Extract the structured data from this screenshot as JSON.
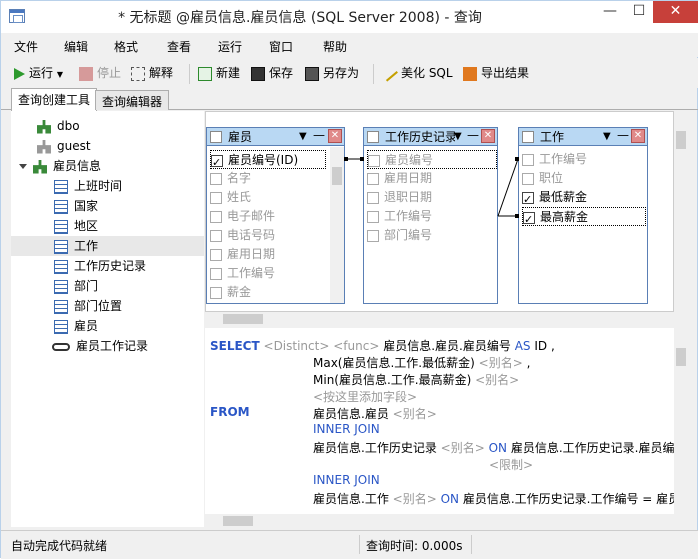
{
  "window": {
    "title": "* 无标题 @雇员信息.雇员信息 (SQL Server 2008) - 查询"
  },
  "menu": [
    "文件",
    "编辑",
    "格式",
    "查看",
    "运行",
    "窗口",
    "帮助"
  ],
  "toolbar": {
    "run": "运行",
    "stop": "停止",
    "explain": "解释",
    "new": "新建",
    "save": "保存",
    "save_as": "另存为",
    "beautify": "美化 SQL",
    "export": "导出结果"
  },
  "tabs": [
    "查询创建工具",
    "查询编辑器"
  ],
  "tree": {
    "schemas": [
      "dbo",
      "guest",
      "雇员信息"
    ],
    "tables": [
      "上班时间",
      "国家",
      "地区",
      "工作",
      "工作历史记录",
      "部门",
      "部门位置",
      "雇员"
    ],
    "views": [
      "雇员工作记录"
    ],
    "selected": "工作"
  },
  "boxes": [
    {
      "name": "雇员",
      "fields": [
        "雇员编号(ID)",
        "名字",
        "姓氏",
        "电子邮件",
        "电话号码",
        "雇用日期",
        "工作编号",
        "薪金"
      ],
      "checked": [
        true,
        false,
        false,
        false,
        false,
        false,
        false,
        false
      ]
    },
    {
      "name": "工作历史记录",
      "fields": [
        "雇员编号",
        "雇用日期",
        "退职日期",
        "工作编号",
        "部门编号"
      ],
      "checked": [
        false,
        false,
        false,
        false,
        false
      ]
    },
    {
      "name": "工作",
      "fields": [
        "工作编号",
        "职位",
        "最低薪金",
        "最高薪金"
      ],
      "checked": [
        false,
        false,
        true,
        true
      ]
    }
  ],
  "sql": {
    "select_kw": "SELECT",
    "distinct": "<Distinct>",
    "func": "<func>",
    "col1": "雇员信息.雇员.雇员编号",
    "as": "AS",
    "id": "ID ,",
    "col2": "Max(雇员信息.工作.最低薪金)",
    "alias": "<别名>",
    "comma": ",",
    "col3": "Min(雇员信息.工作.最高薪金)",
    "add_field": "<按这里添加字段>",
    "from_kw": "FROM",
    "t1": "雇员信息.雇员",
    "join": "INNER JOIN",
    "t2": "雇员信息.工作历史记录",
    "on": "ON",
    "cond2": "雇员信息.工作历史记录.雇员编",
    "limit": "<限制>",
    "t3": "雇员信息.工作",
    "cond3": "雇员信息.工作历史记录.工作编号 = 雇员"
  },
  "status": {
    "left": "自动完成代码就绪",
    "time": "查询时间: 0.000s"
  }
}
